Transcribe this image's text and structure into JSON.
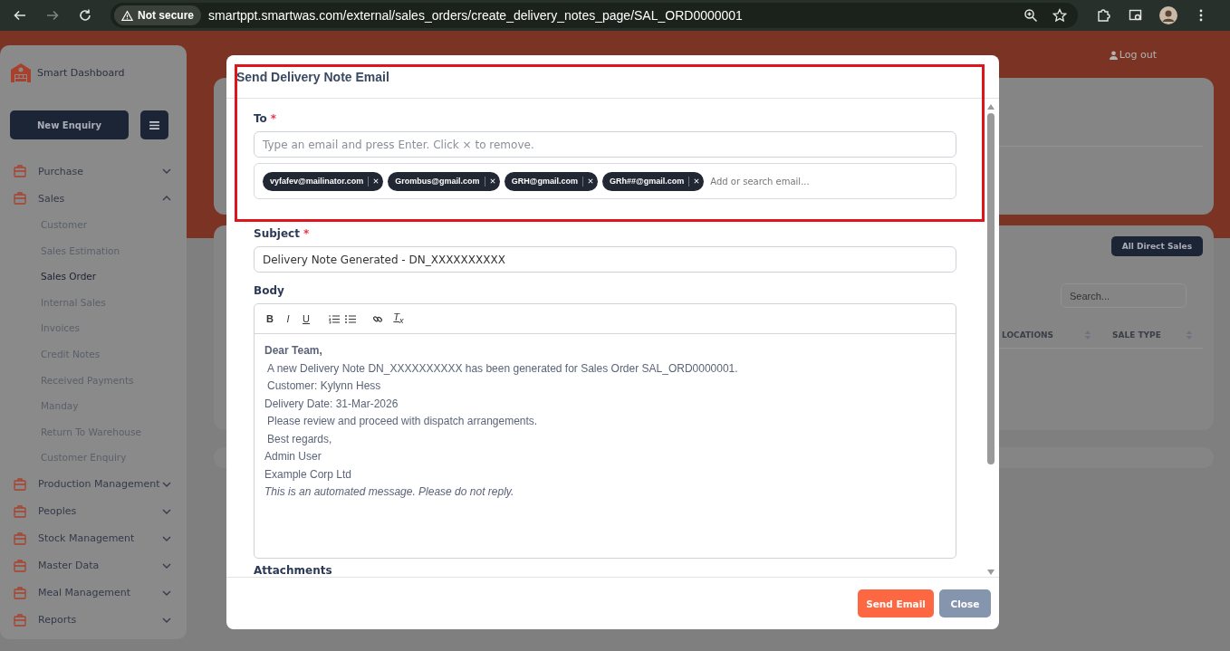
{
  "browser": {
    "security": "Not secure",
    "url": "smartppt.smartwas.com/external/sales_orders/create_delivery_notes_page/SAL_ORD0000001"
  },
  "sidebar": {
    "brand": "Smart Dashboard",
    "new_button": "New Enquiry",
    "items": [
      {
        "label": "Purchase",
        "expanded": false
      },
      {
        "label": "Sales",
        "expanded": true,
        "children": [
          {
            "label": "Customer",
            "selected": false
          },
          {
            "label": "Sales Estimation",
            "selected": false
          },
          {
            "label": "Sales Order",
            "selected": true
          },
          {
            "label": "Internal Sales",
            "selected": false
          },
          {
            "label": "Invoices",
            "selected": false
          },
          {
            "label": "Credit Notes",
            "selected": false
          },
          {
            "label": "Received Payments",
            "selected": false
          },
          {
            "label": "Manday",
            "selected": false
          },
          {
            "label": "Return To Warehouse",
            "selected": false
          },
          {
            "label": "Customer Enquiry",
            "selected": false
          }
        ]
      },
      {
        "label": "Production Management",
        "expanded": false
      },
      {
        "label": "Peoples",
        "expanded": false
      },
      {
        "label": "Stock Management",
        "expanded": false
      },
      {
        "label": "Master Data",
        "expanded": false
      },
      {
        "label": "Meal Management",
        "expanded": false
      },
      {
        "label": "Reports",
        "expanded": false
      }
    ]
  },
  "page": {
    "logout": "Log out",
    "all_button": "All Direct Sales",
    "search_placeholder": "Search...",
    "columns": [
      "LOCATIONS",
      "SALE TYPE"
    ]
  },
  "modal": {
    "title": "Send Delivery Note Email",
    "to": {
      "label": "To",
      "mark": "*",
      "placeholder": "Type an email and press Enter. Click × to remove.",
      "recipients": [
        "vyfafev@mailinator.com",
        "Grombus@gmail.com",
        "GRH@gmail.com",
        "GRh##@gmail.com"
      ],
      "search_placeholder": "Add or search email..."
    },
    "subject": {
      "label": "Subject",
      "mark": "*",
      "value": "Delivery Note Generated - DN_XXXXXXXXXX"
    },
    "body": {
      "label": "Body",
      "format_buttons": [
        "B",
        "I",
        "U",
        "T$_{x}$"
      ],
      "lines": [
        {
          "text": "Dear Team,",
          "kind": "greeting"
        },
        {
          "text": "A new Delivery Note DN_XXXXXXXXXX has been generated for Sales Order SAL_ORD0000001.",
          "kind": "indented"
        },
        {
          "text": "Customer: Kylynn Hess",
          "kind": "indented"
        },
        {
          "text": "Delivery Date: 31-Mar-2026",
          "kind": "plain"
        },
        {
          "text": "Please review and proceed with dispatch arrangements.",
          "kind": "indented"
        },
        {
          "text": "Best regards,",
          "kind": "indented"
        },
        {
          "text": "Admin User",
          "kind": "plain"
        },
        {
          "text": "Example Corp Ltd",
          "kind": "plain"
        },
        {
          "text": "This is an automated message. Please do not reply.",
          "kind": "note"
        }
      ]
    },
    "attachments_label": "Attachments",
    "buttons": [
      {
        "label": "Send Email",
        "kind": "primary"
      },
      {
        "label": "Close",
        "kind": "secondary"
      }
    ]
  }
}
